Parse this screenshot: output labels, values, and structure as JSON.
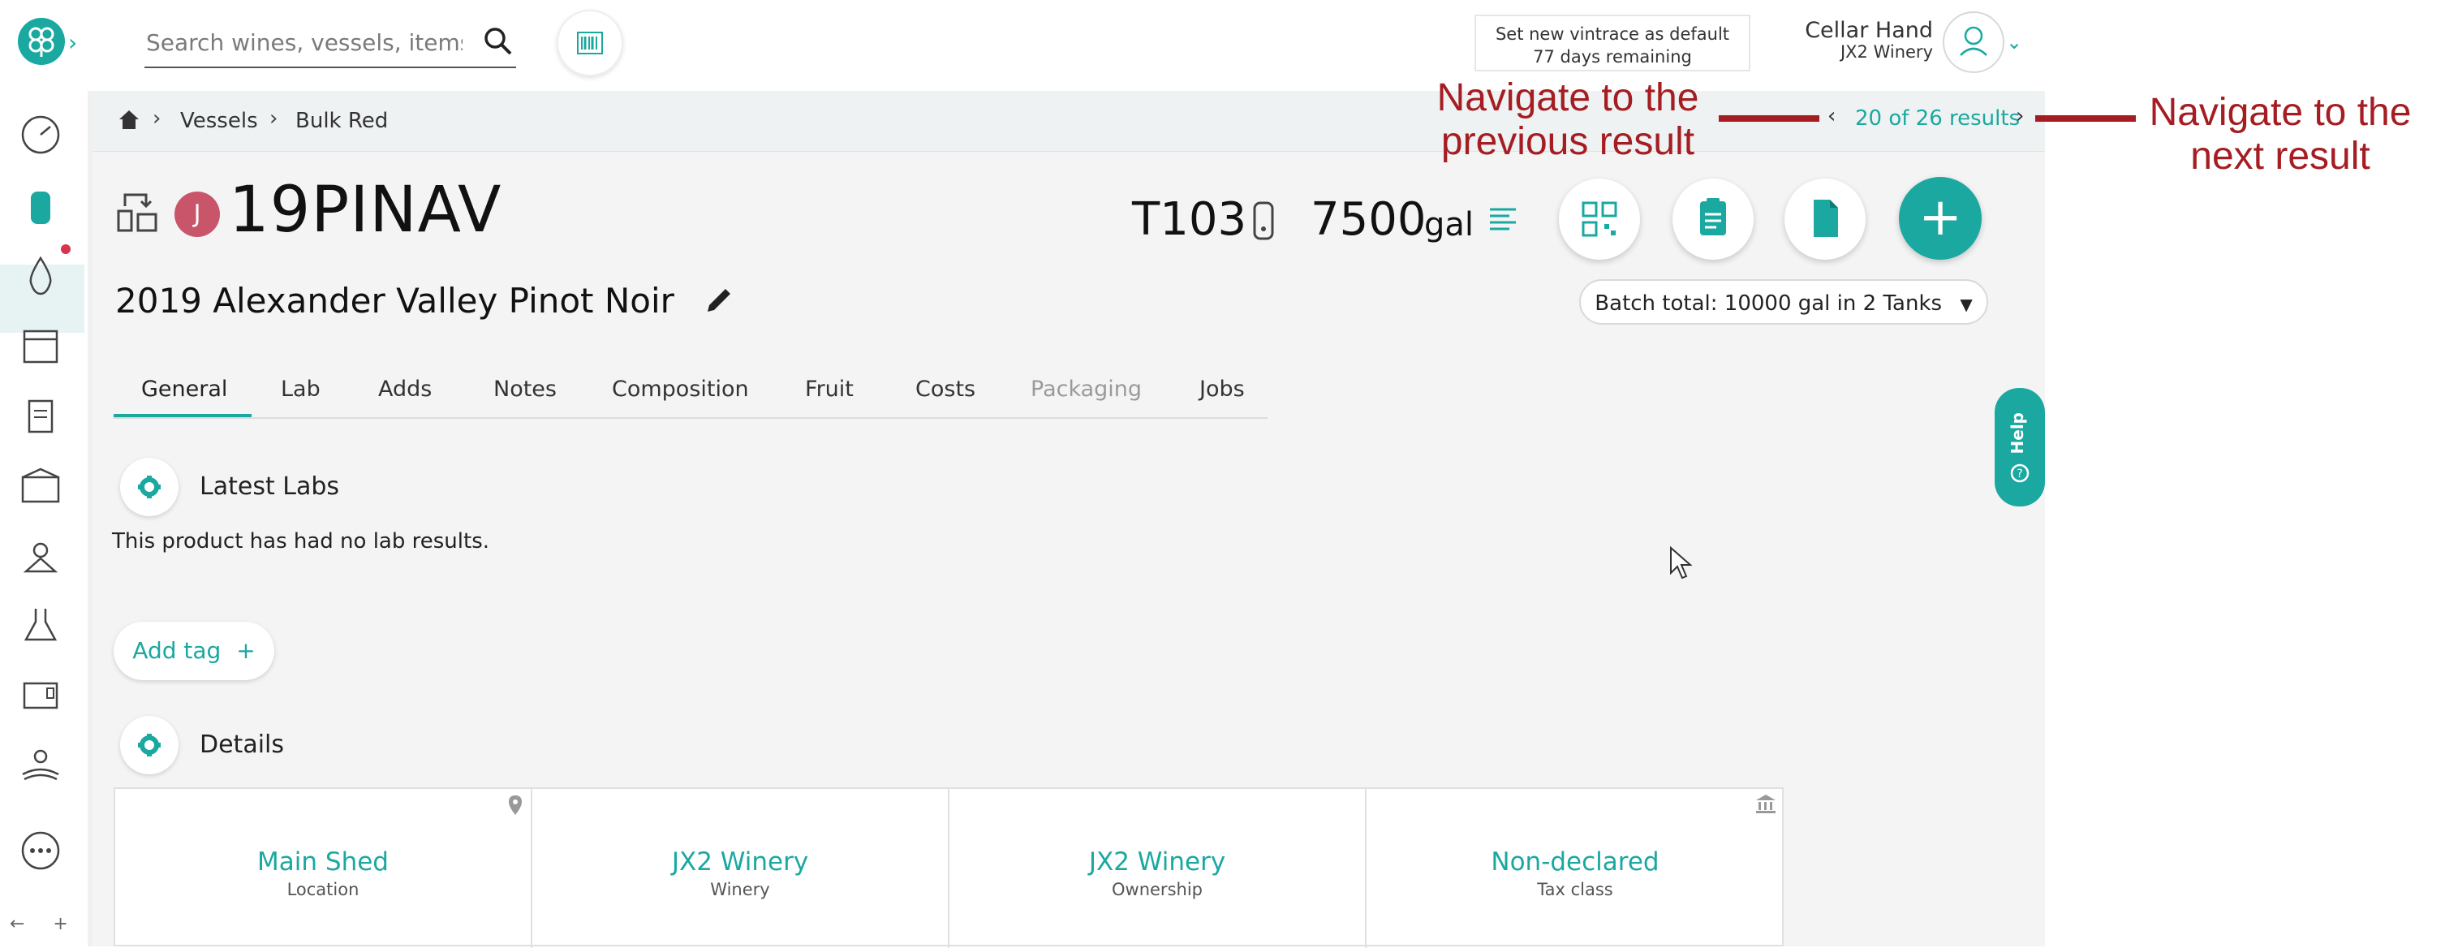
{
  "header": {
    "search_placeholder": "Search wines, vessels, items...",
    "notice_line1": "Set new vintrace as default",
    "notice_line2": "77 days remaining",
    "user_name": "Cellar Hand",
    "user_org": "JX2 Winery"
  },
  "breadcrumb": {
    "items": [
      "Vessels",
      "Bulk Red"
    ]
  },
  "pagination": {
    "label": "20 of 26 results"
  },
  "annotations": {
    "prev": "Navigate to the previous result",
    "next": "Navigate to the next result"
  },
  "vessel": {
    "badge": "J",
    "code": "19PINAV",
    "tank": "T103",
    "volume": "7500",
    "unit": "gal",
    "wine_name": "2019 Alexander Valley Pinot Noir",
    "batch_total": "Batch total: 10000 gal in 2 Tanks"
  },
  "tabs": [
    "General",
    "Lab",
    "Adds",
    "Notes",
    "Composition",
    "Fruit",
    "Costs",
    "Packaging",
    "Jobs"
  ],
  "sections": {
    "latest_labs": "Latest Labs",
    "no_labs": "This product has had no lab results.",
    "add_tag": "Add tag",
    "details": "Details"
  },
  "help_label": "Help",
  "details": [
    {
      "value": "Main Shed",
      "label": "Location"
    },
    {
      "value": "JX2 Winery",
      "label": "Winery"
    },
    {
      "value": "JX2 Winery",
      "label": "Ownership"
    },
    {
      "value": "Non-declared",
      "label": "Tax class"
    }
  ],
  "sidebar_bottom": "← + ?",
  "colors": {
    "accent": "#1aa8a0",
    "annotation": "#a51d22",
    "badge": "#c9556b"
  }
}
